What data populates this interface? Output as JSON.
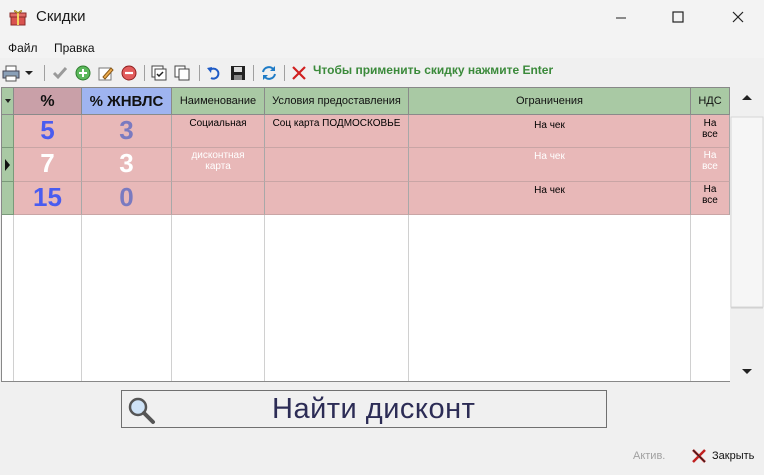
{
  "window": {
    "title": "Скидки"
  },
  "menu": {
    "items": [
      "Файл",
      "Правка"
    ]
  },
  "toolbar": {
    "hint": "Чтобы применить скидку нажмите Enter"
  },
  "grid": {
    "columns": [
      "%",
      "% ЖНВЛС",
      "Наименование",
      "Условия предоставления",
      "Ограничения",
      "НДС"
    ],
    "rows": [
      {
        "pct": "5",
        "zhnvls": "3",
        "name": "Социальная",
        "conditions": "Соц карта ПОДМОСКОВЬЕ",
        "limits": "На чек",
        "nds": "На все",
        "current": false
      },
      {
        "pct": "7",
        "zhnvls": "3",
        "name": "дисконтная карта",
        "conditions": "",
        "limits": "На чек",
        "nds": "На все",
        "current": true
      },
      {
        "pct": "15",
        "zhnvls": "0",
        "name": "",
        "conditions": "",
        "limits": "На чек",
        "nds": "На все",
        "current": false
      }
    ]
  },
  "find_button": {
    "label": "Найти дисконт"
  },
  "footer": {
    "status": "Актив.",
    "close_label": "Закрыть"
  },
  "colors": {
    "row_bg": "#e8b8b8",
    "pct_header": "#c9a0a8",
    "zhnvls_header": "#9fb4f0",
    "other_header": "#a9c9a4",
    "pct_digit": "#4a5cf0",
    "zhnvls_digit": "#7a7ac0",
    "hint_text": "#3b8a3b"
  }
}
